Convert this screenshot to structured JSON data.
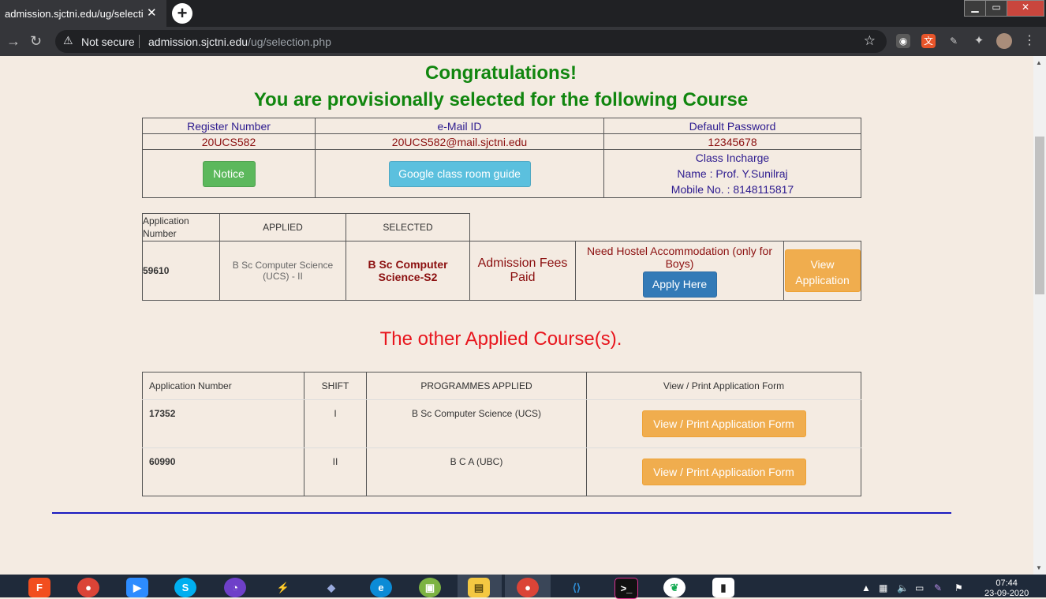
{
  "browser": {
    "tab_title": "admission.sjctni.edu/ug/selection.php",
    "tab_close": "✕",
    "new_tab": "+",
    "win_min": "▁",
    "win_max": "▭",
    "win_close": "✕",
    "back": "→",
    "reload": "↻",
    "not_secure": "Not secure",
    "url_host": "admission.sjctni.edu",
    "url_path": "/ug/selection.php",
    "star": "☆"
  },
  "page": {
    "congrats": "Congratulations!",
    "selected_msg": "You are provisionally selected for the following Course",
    "info": {
      "register_header": "Register Number",
      "email_header": "e-Mail ID",
      "password_header": "Default Password",
      "register_value": "20UCS582",
      "email_value": "20UCS582@mail.sjctni.edu",
      "password_value": "12345678",
      "notice_button": "Notice",
      "google_button": "Google class room guide",
      "incharge_title": "Class Incharge",
      "incharge_name": "Name : Prof. Y.Sunilraj",
      "incharge_mobile": "Mobile No. : 8148115817"
    },
    "application": {
      "h_app_number": "Application Number",
      "h_applied": "APPLIED",
      "h_selected": "SELECTED",
      "app_number": "59610",
      "applied": "B Sc Computer Science (UCS) - II",
      "selected": "B Sc Computer Science-S2",
      "fees_status": "Admission Fees Paid",
      "hostel_text": "Need Hostel Accommodation (only for Boys)",
      "apply_button": "Apply Here",
      "view_button": "View Application"
    },
    "other_heading": "The other Applied Course(s).",
    "other_table": {
      "headers": [
        "Application Number",
        "SHIFT",
        "PROGRAMMES APPLIED",
        "View / Print Application Form"
      ],
      "rows": [
        {
          "app": "17352",
          "shift": "I",
          "programme": "B Sc Computer Science (UCS)",
          "action": "View / Print Application Form"
        },
        {
          "app": "60990",
          "shift": "II",
          "programme": "B C A (UBC)",
          "action": "View / Print Application Form"
        }
      ]
    }
  },
  "taskbar": {
    "time": "07:44",
    "date": "23-09-2020"
  },
  "colors": {
    "page_bg": "#f4ebe2",
    "green_heading": "#11860f",
    "red_heading": "#e8161e",
    "header_blue": "#2d1b8f",
    "value_maroon": "#8b0f0f"
  }
}
